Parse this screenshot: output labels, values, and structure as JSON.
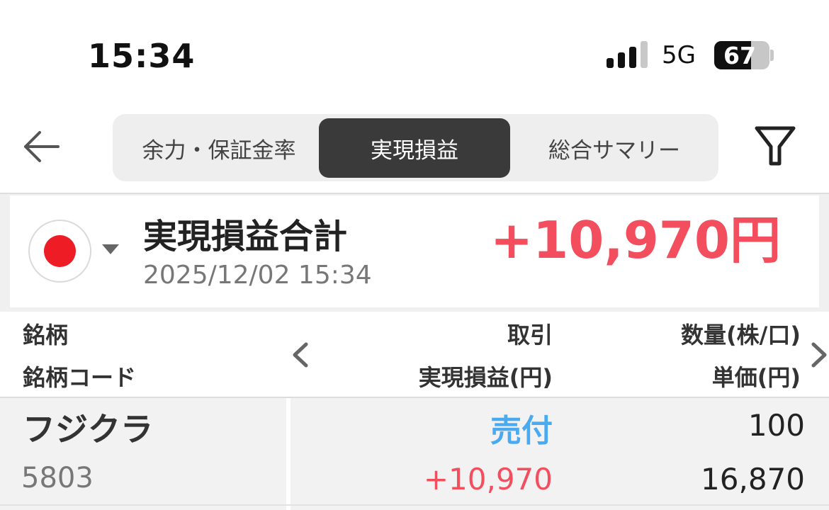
{
  "status_bar": {
    "time": "15:34",
    "network": "5G",
    "battery_level": "67",
    "battery_fraction": 0.67
  },
  "header": {
    "tabs": [
      {
        "label": "余力・保証金率",
        "active": false
      },
      {
        "label": "実現損益",
        "active": true
      },
      {
        "label": "総合サマリー",
        "active": false
      }
    ],
    "back_icon": "arrow-left-icon",
    "filter_icon": "filter-icon"
  },
  "summary": {
    "title": "実現損益合計",
    "timestamp": "2025/12/02 15:34",
    "total": "+10,970円",
    "flag_icon": "japan-flag-icon"
  },
  "table": {
    "headers": {
      "col1_line1": "銘柄",
      "col1_line2": "銘柄コード",
      "col2_line1": "取引",
      "col2_line2": "実現損益(円)",
      "col3_line1": "数量(株/口)",
      "col3_line2": "単価(円)"
    },
    "rows": [
      {
        "name": "フジクラ",
        "code": "5803",
        "trade_type": "売付",
        "realized_pl": "+10,970",
        "quantity": "100",
        "unit_price": "16,870"
      }
    ]
  },
  "colors": {
    "positive": "#f24e5e",
    "sell": "#4aaaf0",
    "active_tab": "#3a3a3a"
  }
}
